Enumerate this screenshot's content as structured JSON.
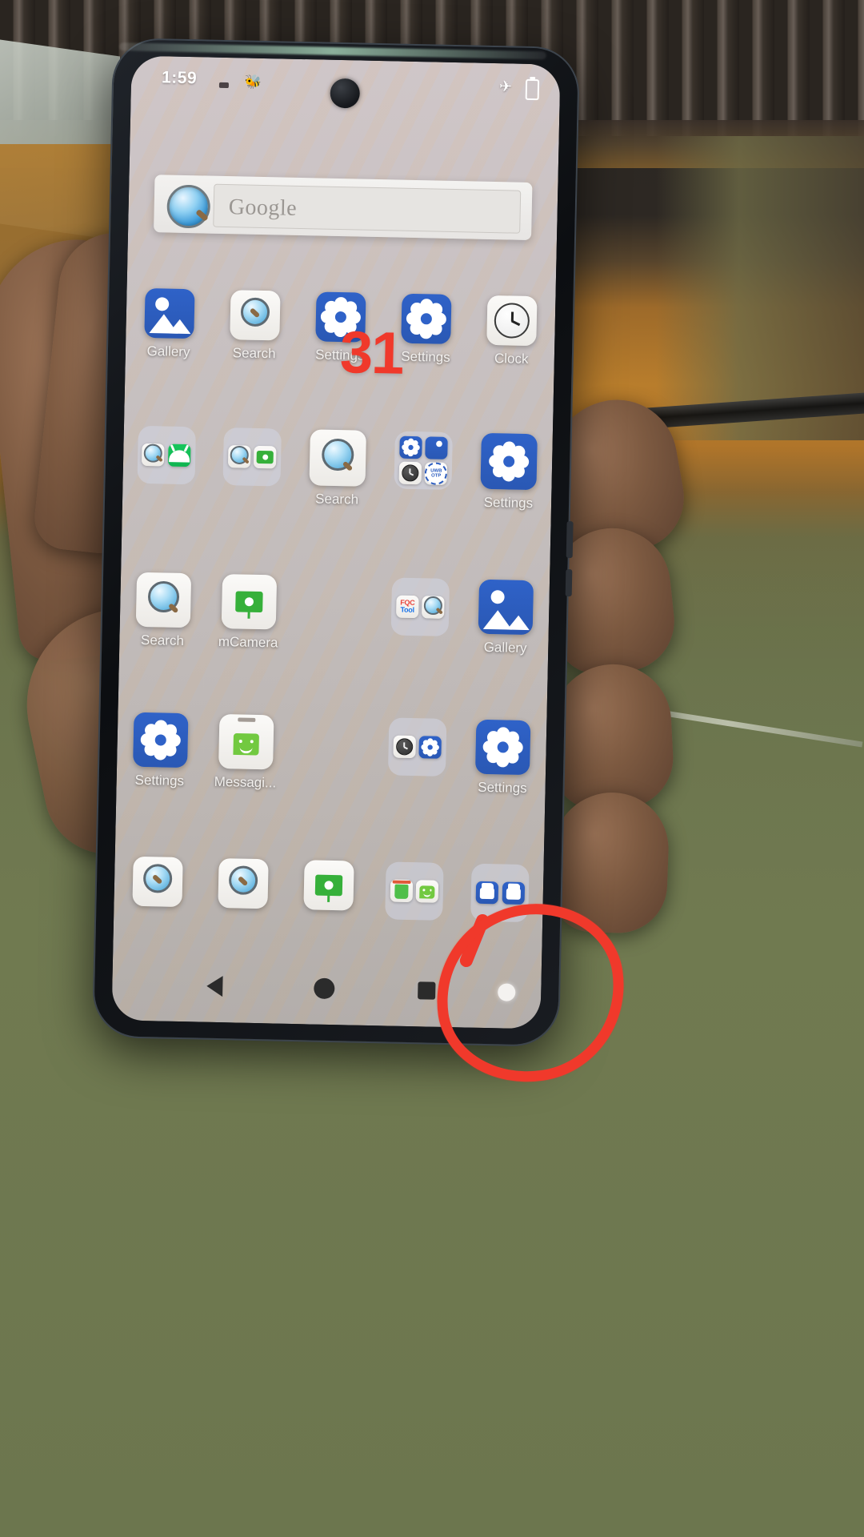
{
  "device": {
    "statusbar": {
      "time": "1:59",
      "icons": [
        "dnd-dot-icon",
        "bug-icon",
        "airplane-mode-icon",
        "battery-icon"
      ],
      "airplane_glyph": "✈"
    },
    "search_widget": {
      "placeholder": "Google",
      "logo": "google-magnifier-icon"
    },
    "navbar": {
      "back": "back-icon",
      "home": "home-icon",
      "recents": "recents-icon"
    }
  },
  "home_rows": [
    {
      "cells": [
        {
          "label": "Gallery",
          "icon": "gallery-icon",
          "type": "app"
        },
        {
          "label": "Search",
          "icon": "search-icon",
          "type": "app"
        },
        {
          "label": "Settings",
          "icon": "settings-icon",
          "type": "app"
        },
        {
          "label": "Settings",
          "icon": "settings-icon",
          "type": "app"
        },
        {
          "label": "Clock",
          "icon": "clock-icon",
          "type": "app"
        }
      ]
    },
    {
      "cells": [
        {
          "label": "",
          "type": "folder",
          "items": [
            "search-icon",
            "android-icon"
          ]
        },
        {
          "label": "",
          "type": "folder",
          "items": [
            "search-icon",
            "camera-icon"
          ]
        },
        {
          "label": "Search",
          "icon": "search-icon",
          "type": "app"
        },
        {
          "label": "",
          "type": "folder",
          "items": [
            "settings-icon",
            "gallery-icon",
            "clock-icon",
            "uwb-otp-icon"
          ]
        },
        {
          "label": "Settings",
          "icon": "settings-icon",
          "type": "app"
        }
      ]
    },
    {
      "cells": [
        {
          "label": "Search",
          "icon": "search-icon",
          "type": "app"
        },
        {
          "label": "mCamera",
          "icon": "camera-icon",
          "type": "app"
        },
        {
          "label": "",
          "type": "empty"
        },
        {
          "label": "",
          "type": "folder",
          "items": [
            "fqc-tool-icon",
            "search-icon"
          ]
        },
        {
          "label": "Gallery",
          "icon": "gallery-icon",
          "type": "app"
        }
      ]
    },
    {
      "cells": [
        {
          "label": "Settings",
          "icon": "settings-icon",
          "type": "app"
        },
        {
          "label": "Messagi...",
          "icon": "messaging-icon",
          "type": "app"
        },
        {
          "label": "",
          "type": "empty"
        },
        {
          "label": "",
          "type": "folder",
          "items": [
            "clock-icon",
            "settings-icon"
          ]
        },
        {
          "label": "Settings",
          "icon": "settings-icon",
          "type": "app"
        }
      ]
    }
  ],
  "dock": {
    "cells": [
      {
        "icon": "search-icon",
        "type": "app"
      },
      {
        "icon": "search-icon",
        "type": "app"
      },
      {
        "icon": "camera-icon",
        "type": "app"
      },
      {
        "type": "folder",
        "items": [
          "trash-icon",
          "messaging-icon"
        ]
      },
      {
        "type": "folder",
        "items": [
          "folder-blue-icon",
          "folder-blue-icon"
        ]
      }
    ]
  },
  "annotations": {
    "number_mark": "31",
    "circle_mark": "red-circle-annotation",
    "color": "#f0392b"
  },
  "icon_text": {
    "fqc_line1": "FQC",
    "fqc_line2": "Tool",
    "uwb_line1": "UWB",
    "uwb_line2": "OTP"
  }
}
